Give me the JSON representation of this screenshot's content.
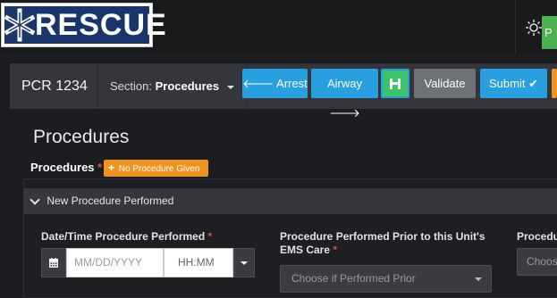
{
  "header": {
    "logo_text": "RESCUE",
    "profile_initial": "P"
  },
  "toolbar": {
    "pcr_label": "PCR 1234",
    "section_prefix": "Section:",
    "section_value": "Procedures",
    "arrest_label": "Arrest",
    "airway_label": "Airway",
    "validate_label": "Validate",
    "submit_label": "Submit"
  },
  "page": {
    "title": "Procedures",
    "procedures_label": "Procedures",
    "required_mark": "*",
    "no_procedure_label": "No Procedure Given"
  },
  "panel": {
    "header": "New Procedure Performed",
    "datetime_label": "Date/Time Procedure Performed",
    "date_placeholder": "MM/DD/YYYY",
    "time_placeholder": "HH:MM",
    "prior_label_line1": "Procedure Performed Prior to this Unit's",
    "prior_label_line2": "EMS Care",
    "prior_placeholder": "Choose if Performed Prior",
    "third_label": "Procedu",
    "third_placeholder": "Choose"
  },
  "colors": {
    "blue_button": "#28a0e0",
    "green_save": "#3cc36b",
    "orange_accent": "#f0931f",
    "required_red": "#d9534f",
    "logo_navy": "#19356b"
  },
  "icons": {
    "logo": "star-of-life-icon",
    "theme": "sun-icon",
    "arrest": "arrow-left-icon",
    "airway": "arrow-right-icon",
    "save": "floppy-disk-icon",
    "submit": "check-icon",
    "date": "calendar-icon",
    "collapse": "chevron-down-icon"
  }
}
